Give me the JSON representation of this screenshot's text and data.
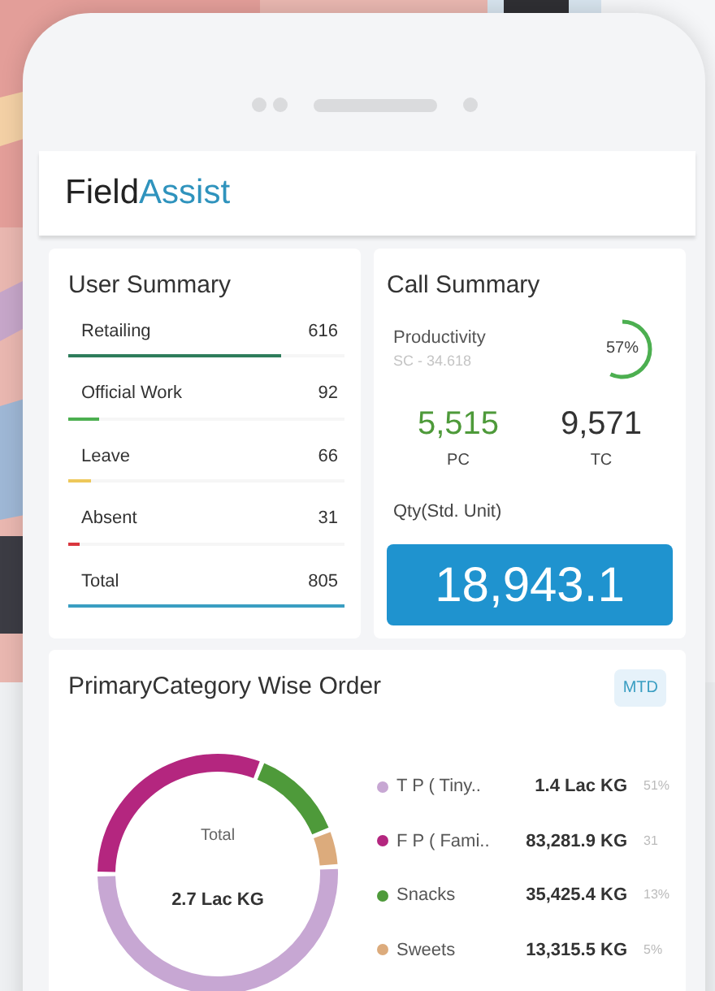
{
  "app": {
    "brand_first": "Field",
    "brand_second": "Assist"
  },
  "user_summary": {
    "title": "User Summary",
    "rows": [
      {
        "label": "Retailing",
        "value": "616",
        "level": 0.77,
        "color": "#2e7d5b"
      },
      {
        "label": "Official Work",
        "value": "92",
        "level": 0.11,
        "color": "#4caf50"
      },
      {
        "label": "Leave",
        "value": "66",
        "level": 0.08,
        "color": "#eec85a"
      },
      {
        "label": "Absent",
        "value": "31",
        "level": 0.04,
        "color": "#d9363e"
      },
      {
        "label": "Total",
        "value": "805",
        "level": 1,
        "color": "#3a9ec2"
      }
    ]
  },
  "call_summary": {
    "title": "Call Summary",
    "productivity_label": "Productivity",
    "productivity_sub": "SC - 34.618",
    "productivity": {
      "reading": "57%",
      "level": 0.57
    },
    "stats": [
      {
        "value": "5,515",
        "label": "PC",
        "color": "#4e9a3a"
      },
      {
        "value": "9,571",
        "label": "TC",
        "color": "#333333"
      }
    ],
    "qty_label": "Qty(Std. Unit)",
    "qty_value": "18,943.1"
  },
  "category_order": {
    "title": "PrimaryCategory Wise Order",
    "period": "MTD",
    "center_label": "Total",
    "center_value": "2.7 Lac KG",
    "legend": [
      {
        "value": "1.4 Lac KG",
        "share": "51%",
        "color": "#c7a7d3"
      },
      {
        "value": "83,281.9 KG",
        "share": "31",
        "color": "#b4267f"
      },
      {
        "value": "35,425.4 KG",
        "share": "13%",
        "color": "#4e9a3a"
      },
      {
        "value": "13,315.5 KG",
        "share": "5%",
        "color": "#dcab7c"
      }
    ],
    "chart_data": {
      "type": "donut",
      "categories": [
        "T P ( Tiny..",
        "F P ( Fami..",
        "Snacks",
        "Sweets"
      ],
      "series": [
        {
          "values": [
            51,
            31,
            13,
            5
          ]
        }
      ]
    }
  }
}
